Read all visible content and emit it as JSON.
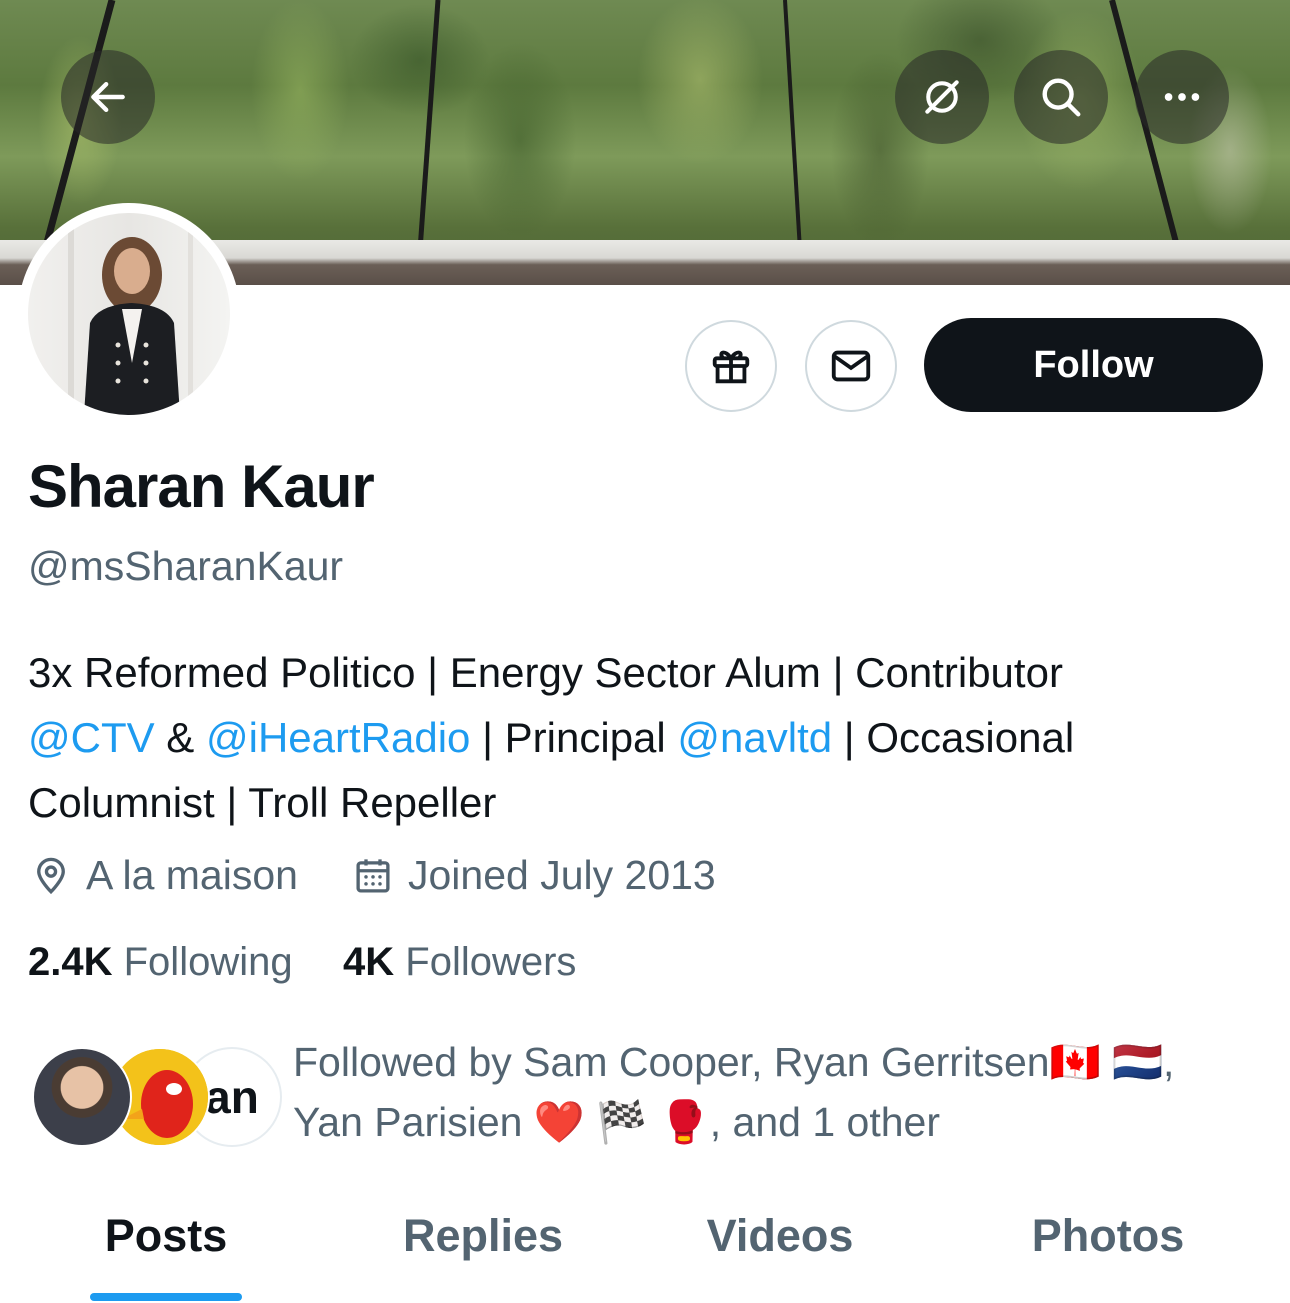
{
  "header": {
    "back_icon": "arrow-left-icon",
    "actions": [
      {
        "icon": "grok-slash-icon"
      },
      {
        "icon": "search-icon"
      },
      {
        "icon": "more-horizontal-icon"
      }
    ]
  },
  "profile": {
    "name": "Sharan Kaur",
    "handle": "@msSharanKaur",
    "follow_label": "Follow",
    "gift_icon": "gift-icon",
    "message_icon": "envelope-icon",
    "bio": {
      "line1": "3x Reformed Politico | Energy Sector Alum | Contributor",
      "link1": "@CTV",
      "amp": " & ",
      "link2": "@iHeartRadio",
      "mid": " | Principal ",
      "link3": "@navltd",
      "tail": " | Occasional",
      "line3": "Columnist | Troll Repeller"
    },
    "location": "A la maison",
    "joined": "Joined July 2013",
    "following_count": "2.4K",
    "following_label": "Following",
    "followers_count": "4K",
    "followers_label": "Followers",
    "followed_by": {
      "line1": "Followed by Sam Cooper, Ryan Gerritsen🇨🇦 🇳🇱,",
      "line2": "Yan Parisien ❤️ 🏁 🥊, and 1 other",
      "third_avatar_text": "an"
    }
  },
  "tabs": [
    {
      "label": "Posts",
      "active": true
    },
    {
      "label": "Replies",
      "active": false
    },
    {
      "label": "Videos",
      "active": false
    },
    {
      "label": "Photos",
      "active": false
    }
  ],
  "colors": {
    "accent": "#1d9bf0",
    "text": "#0f1419",
    "secondary": "#536471"
  }
}
